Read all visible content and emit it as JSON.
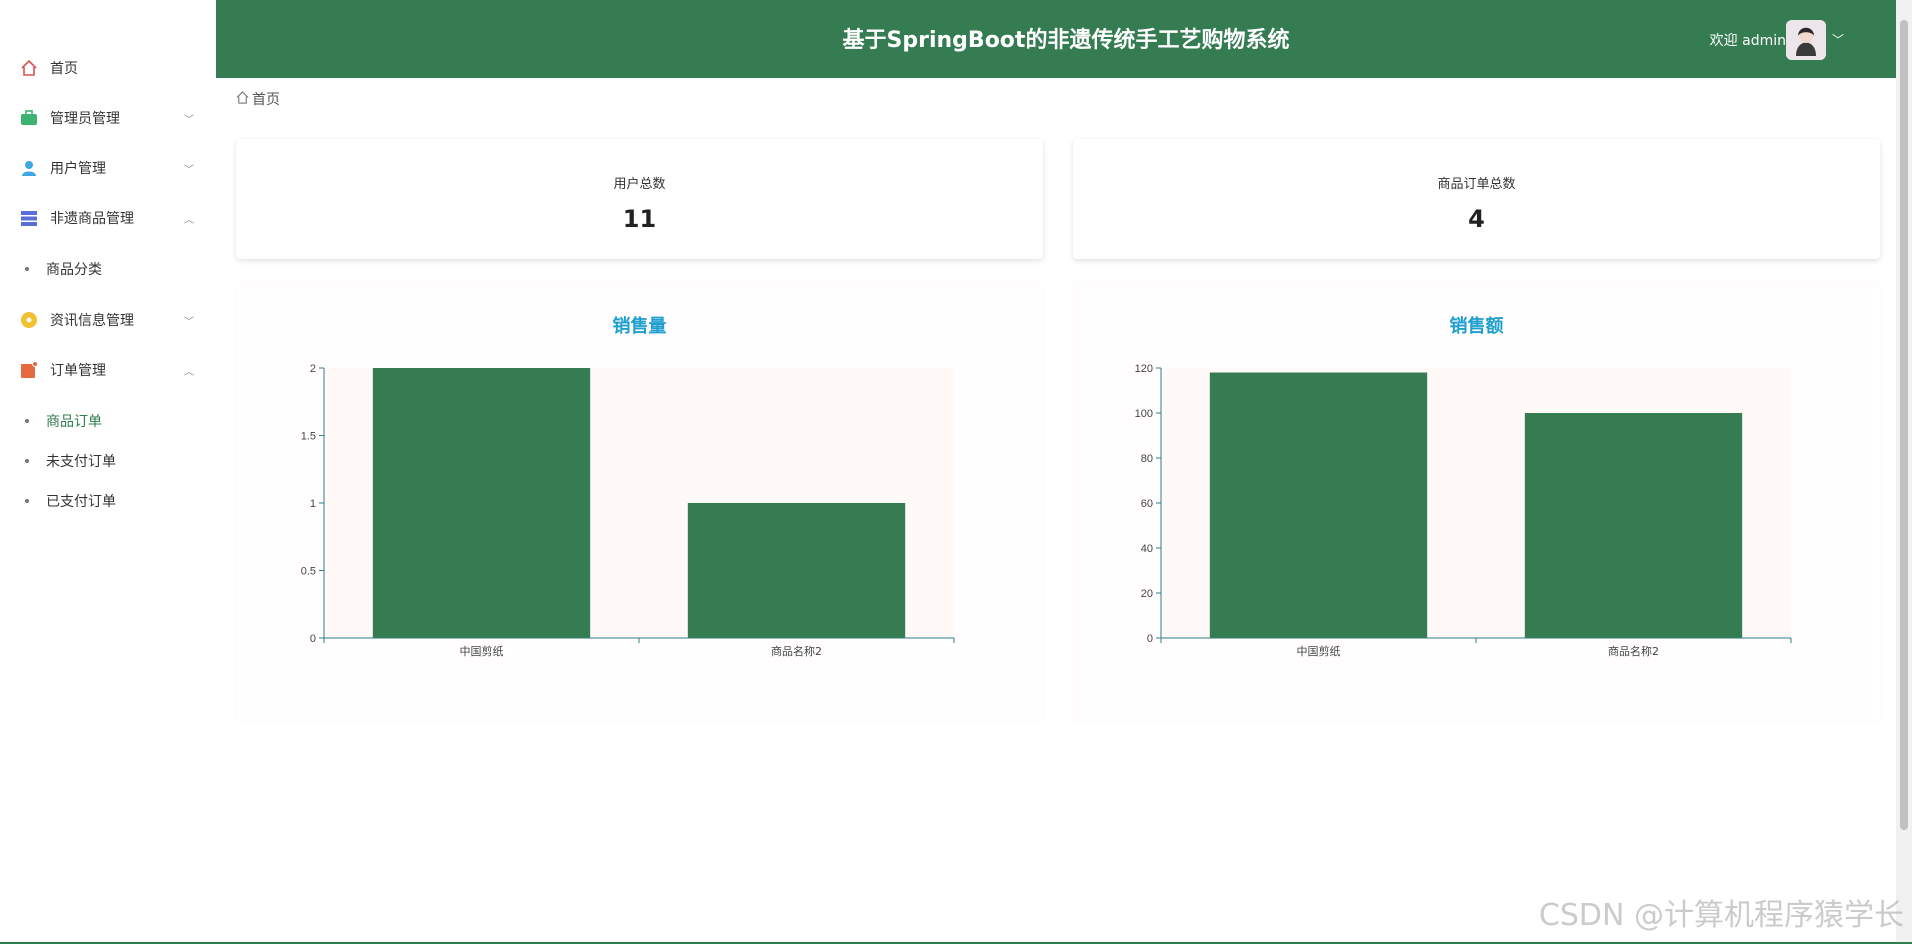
{
  "header": {
    "title": "基于SpringBoot的非遗传统手工艺购物系统",
    "welcome": "欢迎 admin",
    "bg_color": "#357c53"
  },
  "sidebar": {
    "items": [
      {
        "label": "首页",
        "icon": "home-icon",
        "color": "#d9534f"
      },
      {
        "label": "管理员管理",
        "icon": "briefcase-icon",
        "color": "#3cb371"
      },
      {
        "label": "用户管理",
        "icon": "user-icon",
        "color": "#3fa8e0"
      },
      {
        "label": "非遗商品管理",
        "icon": "list-icon",
        "color": "#5a6fd6"
      },
      {
        "label": "资讯信息管理",
        "icon": "news-icon",
        "color": "#f0c030"
      },
      {
        "label": "订单管理",
        "icon": "order-icon",
        "color": "#e4693f"
      }
    ],
    "sub_goods": [
      "商品分类"
    ],
    "sub_orders": [
      "商品订单",
      "未支付订单",
      "已支付订单"
    ]
  },
  "breadcrumb": {
    "home": "首页"
  },
  "stats": [
    {
      "label": "用户总数",
      "value": "11"
    },
    {
      "label": "商品订单总数",
      "value": "4"
    }
  ],
  "charts": {
    "left_title": "销售量",
    "right_title": "销售额"
  },
  "chart_data": [
    {
      "type": "bar",
      "title": "销售量",
      "categories": [
        "中国剪纸",
        "商品名称2"
      ],
      "values": [
        2,
        1
      ],
      "ylim": [
        0,
        2
      ],
      "yticks": [
        "0",
        "0.5",
        "1",
        "1.5",
        "2"
      ],
      "ytick_values": [
        0,
        0.5,
        1,
        1.5,
        2
      ],
      "bar_color": "#357c53",
      "grid": false
    },
    {
      "type": "bar",
      "title": "销售额",
      "categories": [
        "中国剪纸",
        "商品名称2"
      ],
      "values": [
        118,
        100
      ],
      "ylim": [
        0,
        120
      ],
      "yticks": [
        "0",
        "20",
        "40",
        "60",
        "80",
        "100",
        "120"
      ],
      "ytick_values": [
        0,
        20,
        40,
        60,
        80,
        100,
        120
      ],
      "bar_color": "#357c53",
      "grid": false
    }
  ],
  "watermark": "CSDN @计算机程序猿学长"
}
